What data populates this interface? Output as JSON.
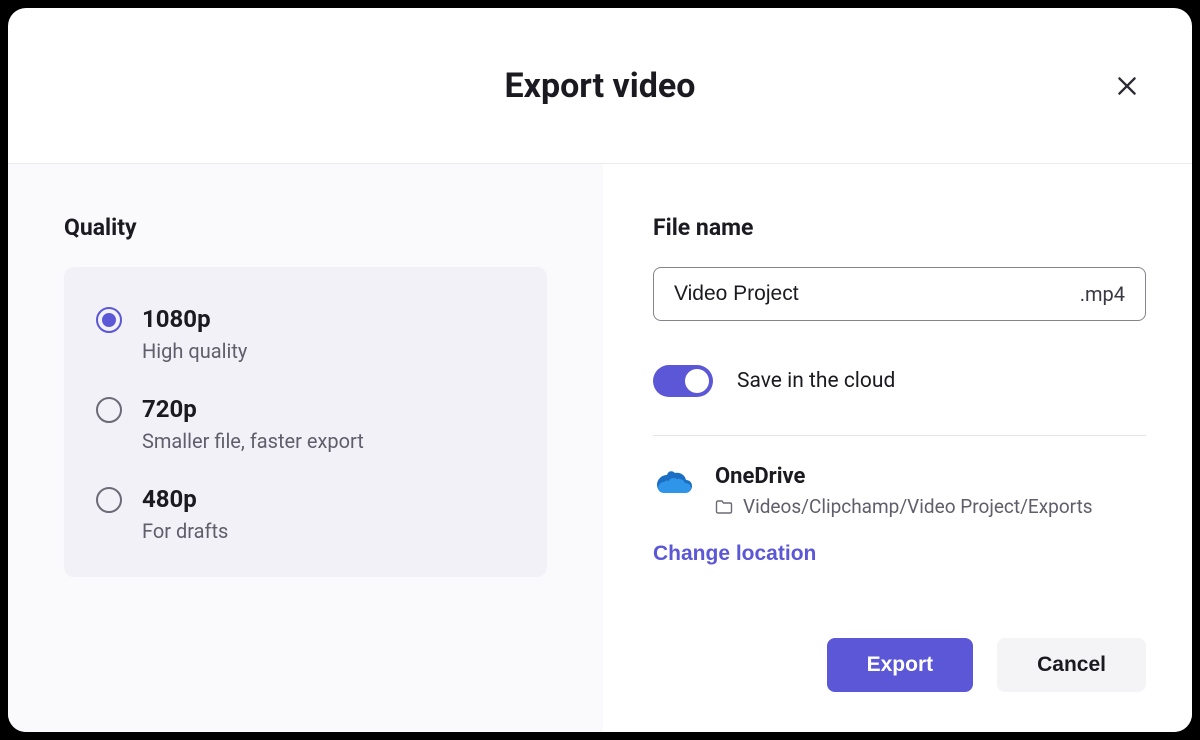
{
  "dialog": {
    "title": "Export video"
  },
  "quality": {
    "label": "Quality",
    "options": [
      {
        "title": "1080p",
        "subtitle": "High quality",
        "selected": true
      },
      {
        "title": "720p",
        "subtitle": "Smaller file, faster export",
        "selected": false
      },
      {
        "title": "480p",
        "subtitle": "For drafts",
        "selected": false
      }
    ]
  },
  "file": {
    "label": "File name",
    "value": "Video Project",
    "extension": ".mp4"
  },
  "cloud": {
    "toggle_label": "Save in the cloud",
    "toggle_on": true,
    "provider": "OneDrive",
    "path": "Videos/Clipchamp/Video Project/Exports",
    "change_label": "Change location"
  },
  "actions": {
    "export": "Export",
    "cancel": "Cancel"
  }
}
